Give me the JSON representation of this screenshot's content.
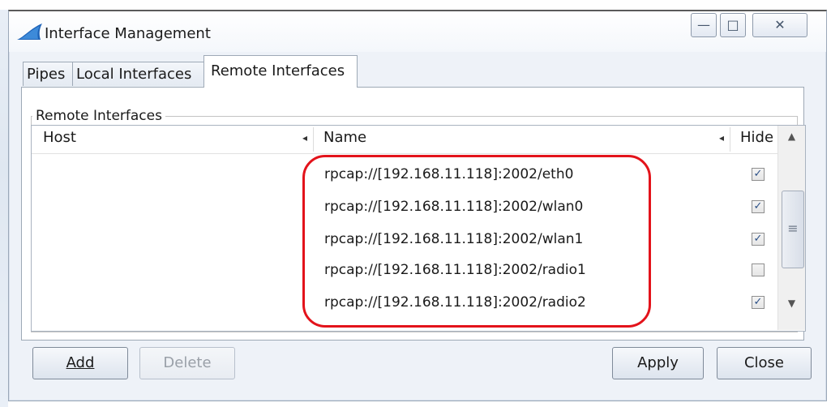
{
  "window": {
    "title": "Interface Management",
    "controls": {
      "minimize": "—",
      "maximize": "□",
      "close": "✕"
    }
  },
  "tabs": [
    {
      "label": "Pipes",
      "active": false
    },
    {
      "label": "Local Interfaces",
      "active": false
    },
    {
      "label": "Remote Interfaces",
      "active": true
    }
  ],
  "group": {
    "label": "Remote Interfaces"
  },
  "table": {
    "columns": [
      "Host",
      "Name",
      "Hide"
    ],
    "rows": [
      {
        "host": "",
        "name": "rpcap://[192.168.11.118]:2002/eth0",
        "hide": true
      },
      {
        "host": "",
        "name": "rpcap://[192.168.11.118]:2002/wlan0",
        "hide": true
      },
      {
        "host": "",
        "name": "rpcap://[192.168.11.118]:2002/wlan1",
        "hide": true
      },
      {
        "host": "",
        "name": "rpcap://[192.168.11.118]:2002/radio1",
        "hide": false
      },
      {
        "host": "",
        "name": "rpcap://[192.168.11.118]:2002/radio2",
        "hide": true
      }
    ]
  },
  "buttons": {
    "add": "Add",
    "delete": "Delete",
    "apply": "Apply",
    "close": "Close"
  },
  "glyphs": {
    "check": "✓",
    "sort_arrow": "◂",
    "scroll_up": "▲",
    "scroll_down": "▼",
    "scroll_grip": "≡"
  },
  "colors": {
    "highlight": "#e3131b",
    "accent": "#2a55c8"
  }
}
